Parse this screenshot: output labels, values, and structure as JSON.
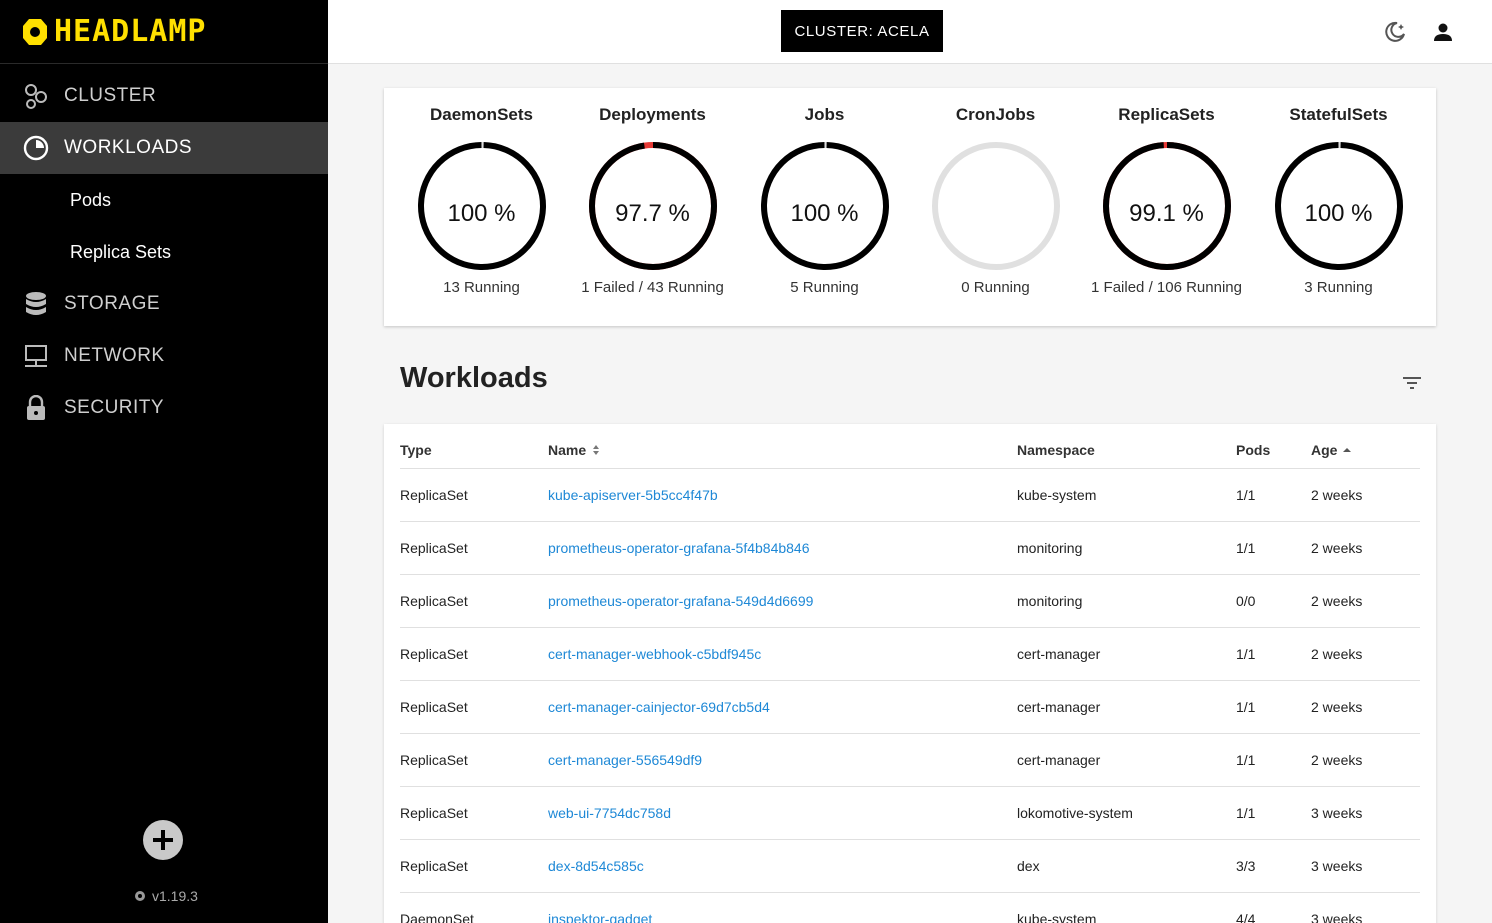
{
  "app": {
    "logo_text": "HEADLAMP",
    "version": "v1.19.3",
    "accent": "#ffe000",
    "link_color": "#1e88d6"
  },
  "sidebar": {
    "items": [
      {
        "label": "CLUSTER",
        "icon": "cluster-icon",
        "active": false
      },
      {
        "label": "WORKLOADS",
        "icon": "workloads-icon",
        "active": true
      },
      {
        "label": "Pods",
        "sub": true
      },
      {
        "label": "Replica Sets",
        "sub": true
      },
      {
        "label": "STORAGE",
        "icon": "storage-icon",
        "active": false
      },
      {
        "label": "NETWORK",
        "icon": "network-icon",
        "active": false
      },
      {
        "label": "SECURITY",
        "icon": "lock-icon",
        "active": false
      }
    ]
  },
  "topbar": {
    "cluster_label": "CLUSTER: ACELA"
  },
  "summary": [
    {
      "title": "DaemonSets",
      "percent": "100 %",
      "ratio": 1.0,
      "legend": "13 Running"
    },
    {
      "title": "Deployments",
      "percent": "97.7 %",
      "ratio": 0.977,
      "legend": "1 Failed / 43 Running"
    },
    {
      "title": "Jobs",
      "percent": "100 %",
      "ratio": 1.0,
      "legend": "5 Running"
    },
    {
      "title": "CronJobs",
      "percent": "",
      "ratio": 0,
      "legend": "0 Running"
    },
    {
      "title": "ReplicaSets",
      "percent": "99.1 %",
      "ratio": 0.991,
      "legend": "1 Failed / 106 Running"
    },
    {
      "title": "StatefulSets",
      "percent": "100 %",
      "ratio": 1.0,
      "legend": "3 Running"
    }
  ],
  "workloads": {
    "title": "Workloads",
    "columns": {
      "type": "Type",
      "name": "Name",
      "namespace": "Namespace",
      "pods": "Pods",
      "age": "Age"
    },
    "rows": [
      {
        "type": "ReplicaSet",
        "name": "kube-apiserver-5b5cc4f47b",
        "namespace": "kube-system",
        "pods": "1/1",
        "age": "2 weeks"
      },
      {
        "type": "ReplicaSet",
        "name": "prometheus-operator-grafana-5f4b84b846",
        "namespace": "monitoring",
        "pods": "1/1",
        "age": "2 weeks"
      },
      {
        "type": "ReplicaSet",
        "name": "prometheus-operator-grafana-549d4d6699",
        "namespace": "monitoring",
        "pods": "0/0",
        "age": "2 weeks"
      },
      {
        "type": "ReplicaSet",
        "name": "cert-manager-webhook-c5bdf945c",
        "namespace": "cert-manager",
        "pods": "1/1",
        "age": "2 weeks"
      },
      {
        "type": "ReplicaSet",
        "name": "cert-manager-cainjector-69d7cb5d4",
        "namespace": "cert-manager",
        "pods": "1/1",
        "age": "2 weeks"
      },
      {
        "type": "ReplicaSet",
        "name": "cert-manager-556549df9",
        "namespace": "cert-manager",
        "pods": "1/1",
        "age": "2 weeks"
      },
      {
        "type": "ReplicaSet",
        "name": "web-ui-7754dc758d",
        "namespace": "lokomotive-system",
        "pods": "1/1",
        "age": "3 weeks"
      },
      {
        "type": "ReplicaSet",
        "name": "dex-8d54c585c",
        "namespace": "dex",
        "pods": "3/3",
        "age": "3 weeks"
      },
      {
        "type": "DaemonSet",
        "name": "inspektor-gadget",
        "namespace": "kube-system",
        "pods": "4/4",
        "age": "3 weeks"
      }
    ]
  }
}
